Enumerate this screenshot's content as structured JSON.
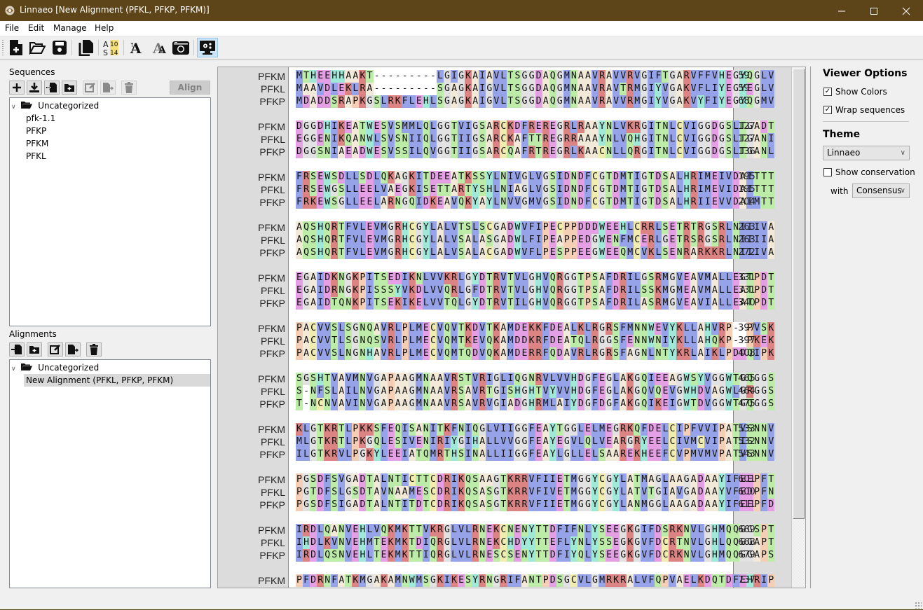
{
  "window": {
    "title": "Linnaeo [New Alignment (PFKL, PFKP, PFKM)]",
    "minimize_icon": "minimize-icon",
    "maximize_icon": "maximize-icon",
    "close_icon": "close-icon"
  },
  "menu": [
    "File",
    "Edit",
    "Manage",
    "Help"
  ],
  "toolbar": {
    "buttons": [
      {
        "icon": "new-file-icon",
        "active": false
      },
      {
        "icon": "open-folder-icon",
        "active": false
      },
      {
        "icon": "save-icon",
        "active": false
      },
      {
        "icon": "copy-icon",
        "active": false
      },
      {
        "icon": "ruler-numbers-icon",
        "active": false,
        "text": "A10 S14"
      },
      {
        "icon": "font-increase-icon",
        "active": false
      },
      {
        "icon": "font-decrease-icon",
        "active": false
      },
      {
        "icon": "screenshot-camera-icon",
        "active": false
      },
      {
        "icon": "viewer-options-icon",
        "active": true
      }
    ]
  },
  "sequences": {
    "label": "Sequences",
    "align_label": "Align",
    "tools": [
      "add-icon",
      "import-icon",
      "add-file-icon",
      "new-folder-icon",
      "edit-icon",
      "export-icon",
      "delete-icon"
    ],
    "tree": {
      "folder": "Uncategorized",
      "items": [
        "pfk-1.1",
        "PFKP",
        "PFKM",
        "PFKL"
      ]
    }
  },
  "alignments": {
    "label": "Alignments",
    "tools": [
      "add-file-icon",
      "new-folder-icon",
      "edit-icon",
      "export-icon",
      "delete-icon"
    ],
    "tree": {
      "folder": "Uncategorized",
      "items": [
        "New Alignment (PFKL, PFKP, PFKM)"
      ],
      "selected": 0
    }
  },
  "viewer": {
    "blocks": [
      {
        "rows": [
          {
            "name": "PFKM",
            "seq": "MTHEEHHAAKT---------LGIGKAIAVLTSGGDAQGMNAAVRAVVRVGIFTGARVFFVHEGYQGLV",
            "end": 59
          },
          {
            "name": "PFKL",
            "seq": "MAAVDLEKLRA---------SGAGKAIGVLTSGGDAQGMNAAVRAVTRMGIYVGAKVFLIYEGYEGLV",
            "end": 59
          },
          {
            "name": "PFKP",
            "seq": "MDADDSRAPKGSLRKFLEHLSGAGKAIGVLTSGGDAQGMNAAVRAVVRMGIYVGAKVYFIYEGYQGMV",
            "end": 68
          }
        ]
      },
      {
        "rows": [
          {
            "name": "PFKM",
            "seq": "DGGDHIKEATWESVSMMLQLGGTVIGSARCKDFREREGRLRAAYNLVKRGITNLCVIGGDGSLTGADT",
            "end": 127
          },
          {
            "name": "PFKL",
            "seq": "EGGENIKQANWLSVSNIIQLGGTIIGSARCKAFTTREGRRAAAYNLVQHGITNLCVIGGDGSLTGANI",
            "end": 127
          },
          {
            "name": "PFKP",
            "seq": "DGGSNIAEADWESVSSILQVGGTIIGSARCQAFRTREGRLKAACNLLQRGITNLCVIGGDGSLTGANL",
            "end": 136
          }
        ]
      },
      {
        "rows": [
          {
            "name": "PFKM",
            "seq": "FRSEWSDLLSDLQKAGKITDEEATKSSYLNIVGLVGSIDNDFCGTDMTIGTDSALHRIMEIVDAITTT",
            "end": 195
          },
          {
            "name": "PFKL",
            "seq": "FRSEWGSLLEELVAEGKISETTARTYSHLNIAGLVGSIDNDFCGTDMTIGTDSALHRIMEVIDAITTT",
            "end": 195
          },
          {
            "name": "PFKP",
            "seq": "FRKEWSGLLEELARNGQIDKEAVQKYAYLNVVGMVGSIDNDFCGTDMTIGTDSALHRIIEVVDAIMTT",
            "end": 204
          }
        ]
      },
      {
        "rows": [
          {
            "name": "PFKM",
            "seq": "AQSHQRTFVLEVMGRHCGYLALVTSLSCGADWVFIPECPPDDDWEEHLCRRLSETRTRGSRLNIIIVA",
            "end": 263
          },
          {
            "name": "PFKL",
            "seq": "AQSHQRTFVLEVMGRHCGYLALVSALASGADWLFIPEAPPEDGWENFMCERLGETRSRGSRLNIIIIA",
            "end": 263
          },
          {
            "name": "PFKP",
            "seq": "AQSHQRTFVLEVMGRHCGYLALVSALACGADWVFLPESPPEEGWEEQMCVKLSENRARKKRLNIIIVA",
            "end": 272
          }
        ]
      },
      {
        "rows": [
          {
            "name": "PFKM",
            "seq": "EGAIDKNGKPITSEDIKNLVVKRLGYDTRVTVLGHVQRGGTPSAFDRILGSRMGVEAVMALLEGTPDT",
            "end": 331
          },
          {
            "name": "PFKL",
            "seq": "EGAIDRNGKPISSSYVKDLVVQRLGFDTRVTVLGHVQRGGTPSAFDRILSSKMGMEAVMALLEATPDT",
            "end": 331
          },
          {
            "name": "PFKP",
            "seq": "EGAIDTQNKPITSEKIKELVVTQLGYDTRVTILGHVQRGGTPSAFDRILASRMGVEAVIALLEATPDT",
            "end": 340
          }
        ]
      },
      {
        "rows": [
          {
            "name": "PFKM",
            "seq": "PACVVSLSGNQAVRLPLMECVQVTKDVTKAMDEKKFDEALKLRGRSFMNNWEVYKLLAHVRP--PVSK",
            "end": 397
          },
          {
            "name": "PFKL",
            "seq": "PACVVTLSGNQSVRLPLMECVQMTKEVQKAMDDKRFDEATQLRGGSFENNWNIYKLLAHQKP--PKEK",
            "end": 397
          },
          {
            "name": "PFKP",
            "seq": "PACVVSLNGNHAVRLPLMECVQMTQDVQKAMDERRFQDAVRLRGRSFAGNLNTYKRLAIKLPDDQIPK",
            "end": 408
          }
        ]
      },
      {
        "rows": [
          {
            "name": "PFKM",
            "seq": "SGSHTVAVMNVGAPAAGMNAAVRSTVRIGLIQGNRVLVVHDGFEGLAKGQIEEAGWSYVGGWTGQGGS",
            "end": 465
          },
          {
            "name": "PFKL",
            "seq": "S-NFSLAILNVGAPAAGMNAAVRSAVRTGISHGHTVYVVHDGFEGLAKGQVQEVGWHDVAGWLGRGGS",
            "end": 464
          },
          {
            "name": "PFKP",
            "seq": "T-NCNVAVINVGAPAAGMNAAVRSAVRVGIADGHRMLAIYDGFDGFAKGQIKEIGWTDVGGWTGQGGS",
            "end": 475
          }
        ]
      },
      {
        "rows": [
          {
            "name": "PFKM",
            "seq": "KLGTKRTLPKKSFEQISANITKFNIQGLVIIGGFEAYTGGLELMEGRKQFDELCIPFVVIPATVSNNV",
            "end": 533
          },
          {
            "name": "PFKL",
            "seq": "MLGTKRTLPKGQLESIVENIRIYGIHALLVVGGFEAYEGVLQLVEARGRYEELCIVMCVIPATISNNV",
            "end": 532
          },
          {
            "name": "PFKP",
            "seq": "ILGTKRVLPGKYLEEIATQMRTHSINALLIIGGFEAYLGLLELSAAREKHEEFCVPMVMVPATVSNNV",
            "end": 543
          }
        ]
      },
      {
        "rows": [
          {
            "name": "PFKM",
            "seq": "PGSDFSVGADTALNTICTTCDRIKQSAAGTKRRVFIIETMGGYCGYLATMAGLAAGADAAYIFEEPFT",
            "end": 601
          },
          {
            "name": "PFKL",
            "seq": "PGTDFSLGSDTAVNAAMESCDRIKQSASGTKRRVFIVETMGGYCGYLATVTGIAVGADAAYVFEDPFN",
            "end": 600
          },
          {
            "name": "PFKP",
            "seq": "PGSDFSIGADTALNTITDTCDRIKQSASGTKRRVFIIETMGGYCGYLANMGGLAAGADAAYIFEEPFD",
            "end": 611
          }
        ]
      },
      {
        "rows": [
          {
            "name": "PFKM",
            "seq": "IRDLQANVEHLVQKMKTTVKRGLVLRNEKCNENYTTDFIFNLYSEEGKGIFDSRKNVLGHMQQGGSPT",
            "end": 669
          },
          {
            "name": "PFKL",
            "seq": "IHDLKVNVEHMTEKMKTDIQRGLVLRNEKCHDYYTTEFLYNLYSSEGKGVFDCRTNVLGHLQQGGAPT",
            "end": 668
          },
          {
            "name": "PFKP",
            "seq": "IRDLQSNVEHLTEKMKTTIQRGLVLRNESCSENYTTDFIYQLYSEEGKGVFDCRKNVLGHMQQGGAPS",
            "end": 679
          }
        ]
      },
      {
        "rows": [
          {
            "name": "PFKM",
            "seq": "PFDRNFATKMGAKAMNWMSGKIKESYRNGRIFANTPDSGCVLGMRKRALVFQPVAELKDQTDFEHRIP",
            "end": 737
          }
        ]
      }
    ],
    "residue_colors": {
      "A": "#f3e9d8",
      "G": "#e2e2e2",
      "P": "#f5cfb5",
      "C": "#f1edb0",
      "M": "#97a3e8",
      "L": "#97a3e8",
      "I": "#97a3e8",
      "V": "#97a3e8",
      "F": "#97a3e8",
      "W": "#a0e8d8",
      "Y": "#a0e8d8",
      "H": "#a0e8d8",
      "S": "#bdeca8",
      "T": "#bdeca8",
      "N": "#bdeca8",
      "Q": "#bdeca8",
      "K": "#dc8484",
      "R": "#dc8484",
      "D": "#e5a0e5",
      "E": "#e5a0e5",
      "-": "#ffffff"
    }
  },
  "viewer_options": {
    "title": "Viewer Options",
    "show_colors": {
      "label": "Show Colors",
      "checked": true
    },
    "wrap_sequences": {
      "label": "Wrap sequences",
      "checked": true
    },
    "theme_title": "Theme",
    "theme_value": "Linnaeo",
    "show_conservation": {
      "label": "Show conservation",
      "checked": false
    },
    "with_label": "with",
    "conservation_value": "Consensus"
  }
}
